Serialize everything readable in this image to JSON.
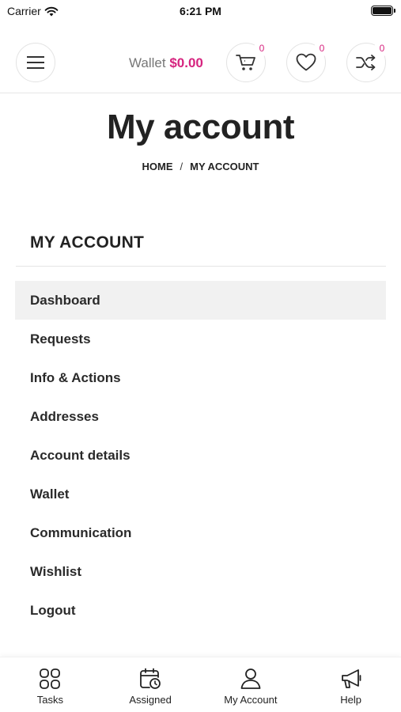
{
  "status_bar": {
    "carrier": "Carrier",
    "time": "6:21 PM"
  },
  "header": {
    "wallet_label": "Wallet",
    "wallet_amount": "$0.00",
    "cart_count": "0",
    "wishlist_count": "0",
    "compare_count": "0",
    "accent_color": "#d6247f"
  },
  "page": {
    "title": "My account",
    "breadcrumb": [
      "HOME",
      "/",
      "MY ACCOUNT"
    ]
  },
  "account_nav": {
    "heading": "MY ACCOUNT",
    "active_index": 0,
    "items": [
      {
        "label": "Dashboard"
      },
      {
        "label": "Requests"
      },
      {
        "label": "Info & Actions"
      },
      {
        "label": "Addresses"
      },
      {
        "label": "Account details"
      },
      {
        "label": "Wallet"
      },
      {
        "label": "Communication"
      },
      {
        "label": "Wishlist"
      },
      {
        "label": "Logout"
      }
    ]
  },
  "tab_bar": {
    "tabs": [
      {
        "label": "Tasks",
        "icon": "grid-icon"
      },
      {
        "label": "Assigned",
        "icon": "calendar-clock-icon"
      },
      {
        "label": "My Account",
        "icon": "user-icon"
      },
      {
        "label": "Help",
        "icon": "megaphone-icon"
      }
    ]
  }
}
